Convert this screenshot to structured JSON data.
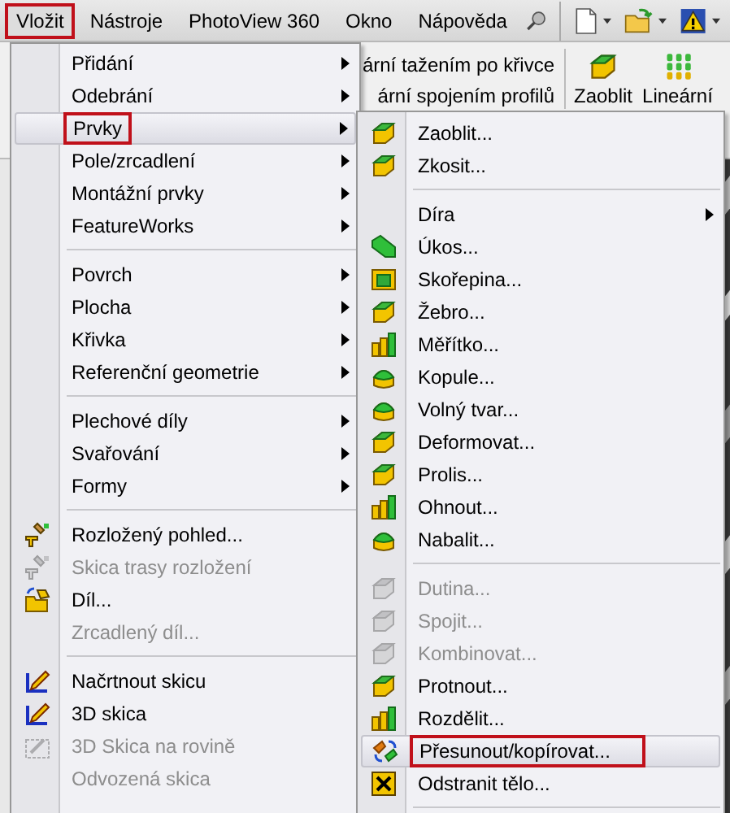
{
  "menubar": [
    {
      "label": "Vložit",
      "selected": true
    },
    {
      "label": "Nástroje",
      "selected": false
    },
    {
      "label": "PhotoView 360",
      "selected": false
    },
    {
      "label": "Okno",
      "selected": false
    },
    {
      "label": "Nápověda",
      "selected": false
    }
  ],
  "toolbar": {
    "commands": [
      {
        "label": "ární tažením po křivce"
      },
      {
        "label": "ární spojením profilů"
      }
    ],
    "buttons": [
      {
        "label": "Zaoblit"
      },
      {
        "label": "Lineární"
      }
    ]
  },
  "insert_menu": {
    "items": [
      {
        "kind": "item",
        "label": "Přidání",
        "submenu": true,
        "disabled": false,
        "selected": false,
        "outlined": false
      },
      {
        "kind": "item",
        "label": "Odebrání",
        "submenu": true,
        "disabled": false,
        "selected": false,
        "outlined": false
      },
      {
        "kind": "item",
        "label": "Prvky",
        "submenu": true,
        "disabled": false,
        "selected": true,
        "outlined": true
      },
      {
        "kind": "item",
        "label": "Pole/zrcadlení",
        "submenu": true,
        "disabled": false,
        "selected": false,
        "outlined": false
      },
      {
        "kind": "item",
        "label": "Montážní prvky",
        "submenu": true,
        "disabled": false,
        "selected": false,
        "outlined": false
      },
      {
        "kind": "item",
        "label": "FeatureWorks",
        "submenu": true,
        "disabled": false,
        "selected": false,
        "outlined": false
      },
      {
        "kind": "separator"
      },
      {
        "kind": "item",
        "label": "Povrch",
        "submenu": true,
        "disabled": false,
        "selected": false,
        "outlined": false
      },
      {
        "kind": "item",
        "label": "Plocha",
        "submenu": true,
        "disabled": false,
        "selected": false,
        "outlined": false
      },
      {
        "kind": "item",
        "label": "Křivka",
        "submenu": true,
        "disabled": false,
        "selected": false,
        "outlined": false
      },
      {
        "kind": "item",
        "label": "Referenční geometrie",
        "submenu": true,
        "disabled": false,
        "selected": false,
        "outlined": false
      },
      {
        "kind": "separator"
      },
      {
        "kind": "item",
        "label": "Plechové díly",
        "submenu": true,
        "disabled": false,
        "selected": false,
        "outlined": false
      },
      {
        "kind": "item",
        "label": "Svařování",
        "submenu": true,
        "disabled": false,
        "selected": false,
        "outlined": false
      },
      {
        "kind": "item",
        "label": "Formy",
        "submenu": true,
        "disabled": false,
        "selected": false,
        "outlined": false
      },
      {
        "kind": "separator"
      },
      {
        "kind": "item",
        "label": "Rozložený pohled...",
        "submenu": false,
        "disabled": false,
        "selected": false,
        "outlined": false
      },
      {
        "kind": "item",
        "label": "Skica trasy rozložení",
        "submenu": false,
        "disabled": true,
        "selected": false,
        "outlined": false
      },
      {
        "kind": "item",
        "label": "Díl...",
        "submenu": false,
        "disabled": false,
        "selected": false,
        "outlined": false
      },
      {
        "kind": "item",
        "label": "Zrcadlený díl...",
        "submenu": false,
        "disabled": true,
        "selected": false,
        "outlined": false
      },
      {
        "kind": "separator"
      },
      {
        "kind": "item",
        "label": "Načrtnout skicu",
        "submenu": false,
        "disabled": false,
        "selected": false,
        "outlined": false
      },
      {
        "kind": "item",
        "label": "3D skica",
        "submenu": false,
        "disabled": false,
        "selected": false,
        "outlined": false
      },
      {
        "kind": "item",
        "label": "3D Skica na rovině",
        "submenu": false,
        "disabled": true,
        "selected": false,
        "outlined": false
      },
      {
        "kind": "item",
        "label": "Odvozená skica",
        "submenu": false,
        "disabled": true,
        "selected": false,
        "outlined": false
      }
    ]
  },
  "features_submenu": {
    "items": [
      {
        "kind": "item",
        "label": "Zaoblit...",
        "submenu": false,
        "disabled": false,
        "selected": false,
        "outlined": false
      },
      {
        "kind": "item",
        "label": "Zkosit...",
        "submenu": false,
        "disabled": false,
        "selected": false,
        "outlined": false
      },
      {
        "kind": "separator"
      },
      {
        "kind": "item",
        "label": "Díra",
        "submenu": true,
        "disabled": false,
        "selected": false,
        "outlined": false
      },
      {
        "kind": "item",
        "label": "Úkos...",
        "submenu": false,
        "disabled": false,
        "selected": false,
        "outlined": false
      },
      {
        "kind": "item",
        "label": "Skořepina...",
        "submenu": false,
        "disabled": false,
        "selected": false,
        "outlined": false
      },
      {
        "kind": "item",
        "label": "Žebro...",
        "submenu": false,
        "disabled": false,
        "selected": false,
        "outlined": false
      },
      {
        "kind": "item",
        "label": "Měřítko...",
        "submenu": false,
        "disabled": false,
        "selected": false,
        "outlined": false
      },
      {
        "kind": "item",
        "label": "Kopule...",
        "submenu": false,
        "disabled": false,
        "selected": false,
        "outlined": false
      },
      {
        "kind": "item",
        "label": "Volný tvar...",
        "submenu": false,
        "disabled": false,
        "selected": false,
        "outlined": false
      },
      {
        "kind": "item",
        "label": "Deformovat...",
        "submenu": false,
        "disabled": false,
        "selected": false,
        "outlined": false
      },
      {
        "kind": "item",
        "label": "Prolis...",
        "submenu": false,
        "disabled": false,
        "selected": false,
        "outlined": false
      },
      {
        "kind": "item",
        "label": "Ohnout...",
        "submenu": false,
        "disabled": false,
        "selected": false,
        "outlined": false
      },
      {
        "kind": "item",
        "label": "Nabalit...",
        "submenu": false,
        "disabled": false,
        "selected": false,
        "outlined": false
      },
      {
        "kind": "separator"
      },
      {
        "kind": "item",
        "label": "Dutina...",
        "submenu": false,
        "disabled": true,
        "selected": false,
        "outlined": false
      },
      {
        "kind": "item",
        "label": "Spojit...",
        "submenu": false,
        "disabled": true,
        "selected": false,
        "outlined": false
      },
      {
        "kind": "item",
        "label": "Kombinovat...",
        "submenu": false,
        "disabled": true,
        "selected": false,
        "outlined": false
      },
      {
        "kind": "item",
        "label": "Protnout...",
        "submenu": false,
        "disabled": false,
        "selected": false,
        "outlined": false
      },
      {
        "kind": "item",
        "label": "Rozdělit...",
        "submenu": false,
        "disabled": false,
        "selected": false,
        "outlined": false
      },
      {
        "kind": "item",
        "label": "Přesunout/kopírovat...",
        "submenu": false,
        "disabled": false,
        "selected": true,
        "outlined": true
      },
      {
        "kind": "item",
        "label": "Odstranit tělo...",
        "submenu": false,
        "disabled": false,
        "selected": false,
        "outlined": false
      },
      {
        "kind": "separator"
      }
    ]
  }
}
